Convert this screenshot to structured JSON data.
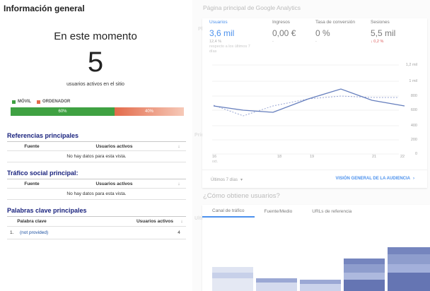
{
  "realtime": {
    "title": "Información general",
    "now_label": "En este momento",
    "active_users": "5",
    "active_users_caption": "usuarios activos en el sitio",
    "devices": [
      {
        "name": "MÓVIL",
        "percent_label": "60%",
        "share": 0.6,
        "color": "#3fa142"
      },
      {
        "name": "ORDENADOR",
        "percent_label": "40%",
        "share": 0.4,
        "color": "#e36b4b"
      }
    ]
  },
  "referrals": {
    "title": "Referencias principales",
    "col_source": "Fuente",
    "col_users": "Usuarios activos",
    "sort_icon": "arrow-down-icon",
    "empty": "No hay datos para esta vista."
  },
  "social": {
    "title": "Tráfico social principal:",
    "col_source": "Fuente",
    "col_users": "Usuarios activos",
    "sort_icon": "arrow-down-icon",
    "empty": "No hay datos para esta vista."
  },
  "keywords": {
    "title": "Palabras clave principales",
    "col_keyword": "Palabra clave",
    "col_users": "Usuarios activos",
    "sort_icon": "arrow-down-icon",
    "rows": [
      {
        "index": "1.",
        "keyword": "(not provided)",
        "users": "4"
      }
    ]
  },
  "ga_home": {
    "header": "Página principal de Google Analytics",
    "ghost_left": "Pl",
    "ghost_left2": "Princ",
    "ghost_left3": "Ultim",
    "metrics": [
      {
        "label": "Usuarios",
        "value": "3,6 mil",
        "delta": "12,4 %",
        "delta_note": "respecto a los últimos 7",
        "delta_note2": "días",
        "active": true
      },
      {
        "label": "Ingresos",
        "value": "0,00 €",
        "delta": "-",
        "active": false
      },
      {
        "label": "Tasa de conversión",
        "value": "0 %",
        "delta": "-",
        "active": false
      },
      {
        "label": "Sesiones",
        "value": "5,5 mil",
        "delta": "↓ 0,2 %",
        "active": false
      }
    ],
    "y_ticks": [
      "1,2 mil",
      "1 mil",
      "800",
      "600",
      "400",
      "200",
      "0"
    ],
    "x_ticks": [
      "16",
      "18",
      "19",
      "21",
      "22"
    ],
    "x_sub": "oct.",
    "range_label": "Últimos 7 días",
    "range_caret": "▾",
    "audience_link": "VISIÓN GENERAL DE LA AUDIENCIA",
    "audience_chevron": "›",
    "question": "¿Cómo obtiene usuarios?",
    "tabs": [
      "Canal de tráfico",
      "Fuente/Medio",
      "URLs de referencia"
    ],
    "colors": {
      "accent": "#1a73e8",
      "line": "#3b5bab",
      "dash": "#7e8fc8"
    }
  }
}
